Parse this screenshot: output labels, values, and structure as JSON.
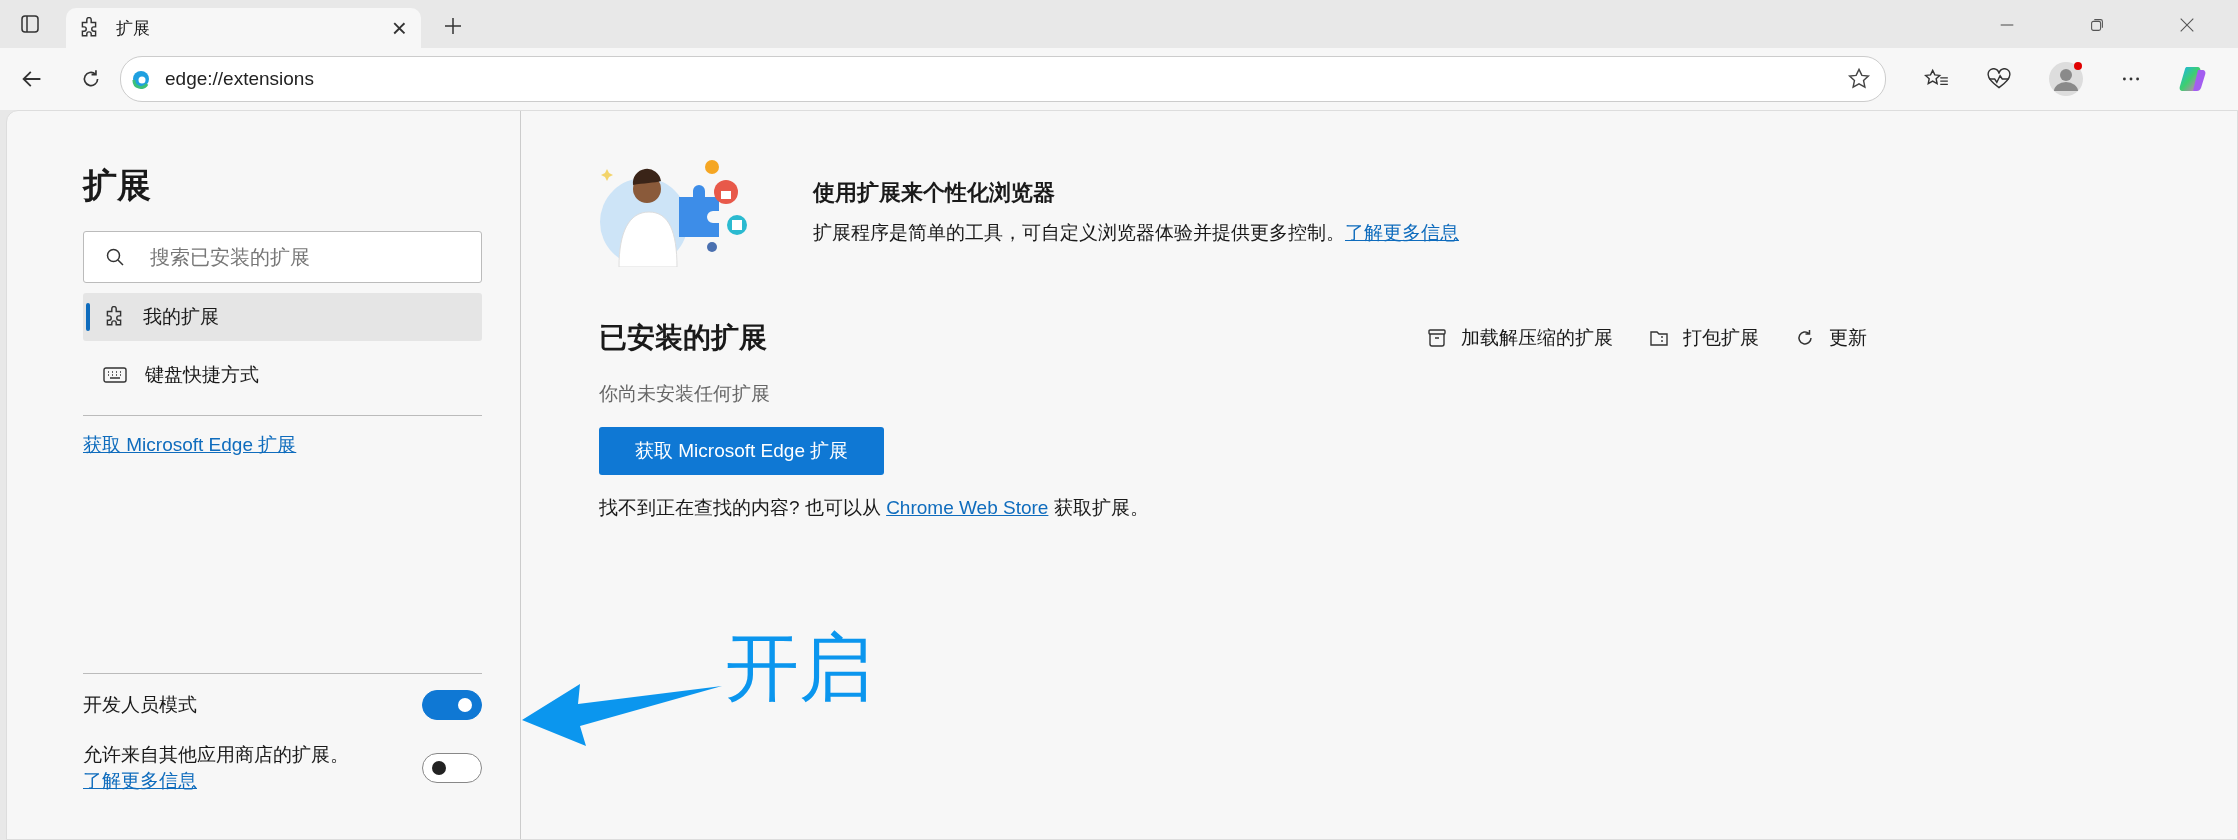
{
  "tab": {
    "title": "扩展",
    "close": "×"
  },
  "address": {
    "url": "edge://extensions"
  },
  "sidebar": {
    "title": "扩展",
    "search": {
      "placeholder": "搜索已安装的扩展"
    },
    "items": [
      {
        "label": "我的扩展",
        "kind": "puzzle",
        "selected": true
      },
      {
        "label": "键盘快捷方式",
        "kind": "keyboard",
        "selected": false
      }
    ],
    "store_link": "获取 Microsoft Edge 扩展",
    "settings": [
      {
        "label": "开发人员模式",
        "on": true
      },
      {
        "label": "允许来自其他应用商店的扩展。",
        "link": "了解更多信息",
        "on": false
      }
    ]
  },
  "banner": {
    "title": "使用扩展来个性化浏览器",
    "text": "扩展程序是简单的工具，可自定义浏览器体验并提供更多控制。",
    "link": "了解更多信息"
  },
  "installed": {
    "title": "已安装的扩展",
    "actions": [
      {
        "label": "加载解压缩的扩展",
        "kind": "load"
      },
      {
        "label": "打包扩展",
        "kind": "pack"
      },
      {
        "label": "更新",
        "kind": "update"
      }
    ],
    "empty": "你尚未安装任何扩展",
    "button": "获取 Microsoft Edge 扩展",
    "hint_before": "找不到正在查找的内容? 也可以从",
    "hint_link": "Chrome Web Store",
    "hint_after": "获取扩展。"
  },
  "annotation": {
    "label": "开启"
  }
}
